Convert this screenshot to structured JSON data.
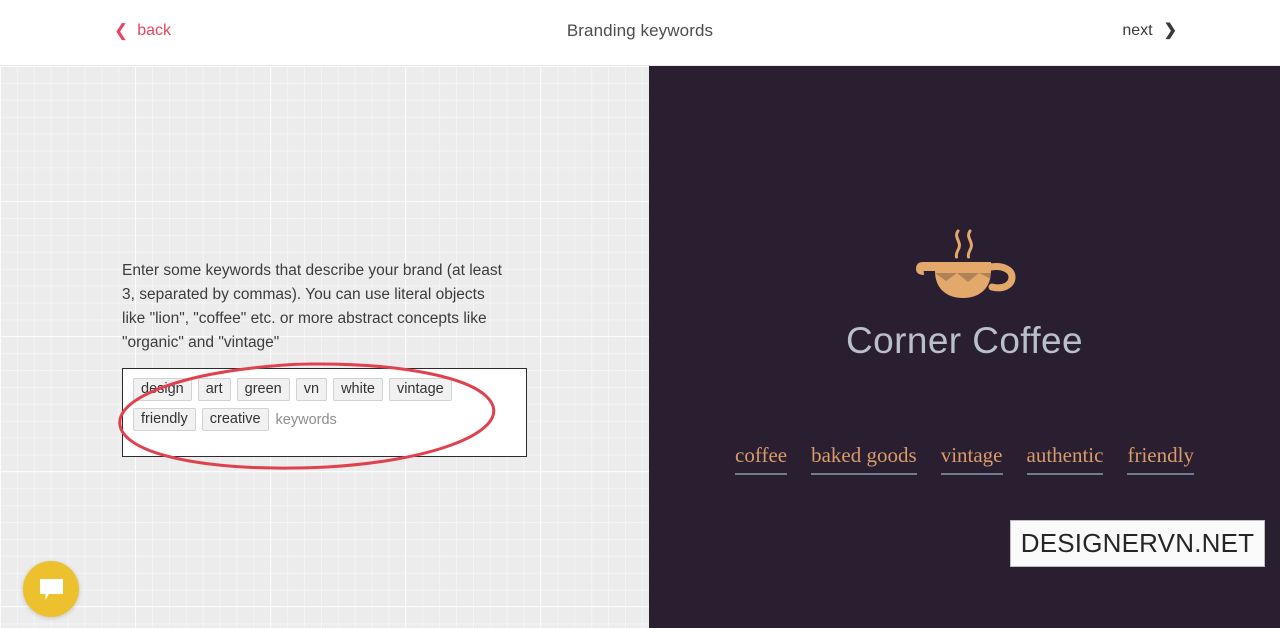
{
  "header": {
    "back_label": "back",
    "back_icon": "chevron-left-icon",
    "back_color": "#e8445f",
    "title": "Branding keywords",
    "next_label": "next",
    "next_icon": "chevron-right-icon",
    "next_color": "#3a3a3a"
  },
  "form": {
    "instructions": "Enter some keywords that describe your brand (at least 3, separated by commas). You can use literal objects like \"lion\", \"coffee\" etc. or more abstract concepts like \"organic\" and \"vintage\"",
    "tags": [
      "design",
      "art",
      "green",
      "vn",
      "white",
      "vintage",
      "friendly",
      "creative"
    ],
    "placeholder": "keywords"
  },
  "annotation": {
    "shape": "ellipse",
    "color": "#e0414f",
    "target": "tag-field"
  },
  "chat": {
    "icon": "chat-bubble-icon",
    "color": "#edc02e"
  },
  "preview": {
    "background_color": "#2a1f30",
    "logo_icon": "coffee-cup-icon",
    "logo_color": "#e3a86a",
    "brand_name": "Corner Coffee",
    "brand_name_color": "#b9bfcb",
    "keywords": [
      "coffee",
      "baked goods",
      "vintage",
      "authentic",
      "friendly"
    ],
    "keyword_color": "#d89b6a",
    "keyword_underline_color": "#717c8c"
  },
  "watermark": {
    "text": "DESIGNERVN.NET"
  }
}
